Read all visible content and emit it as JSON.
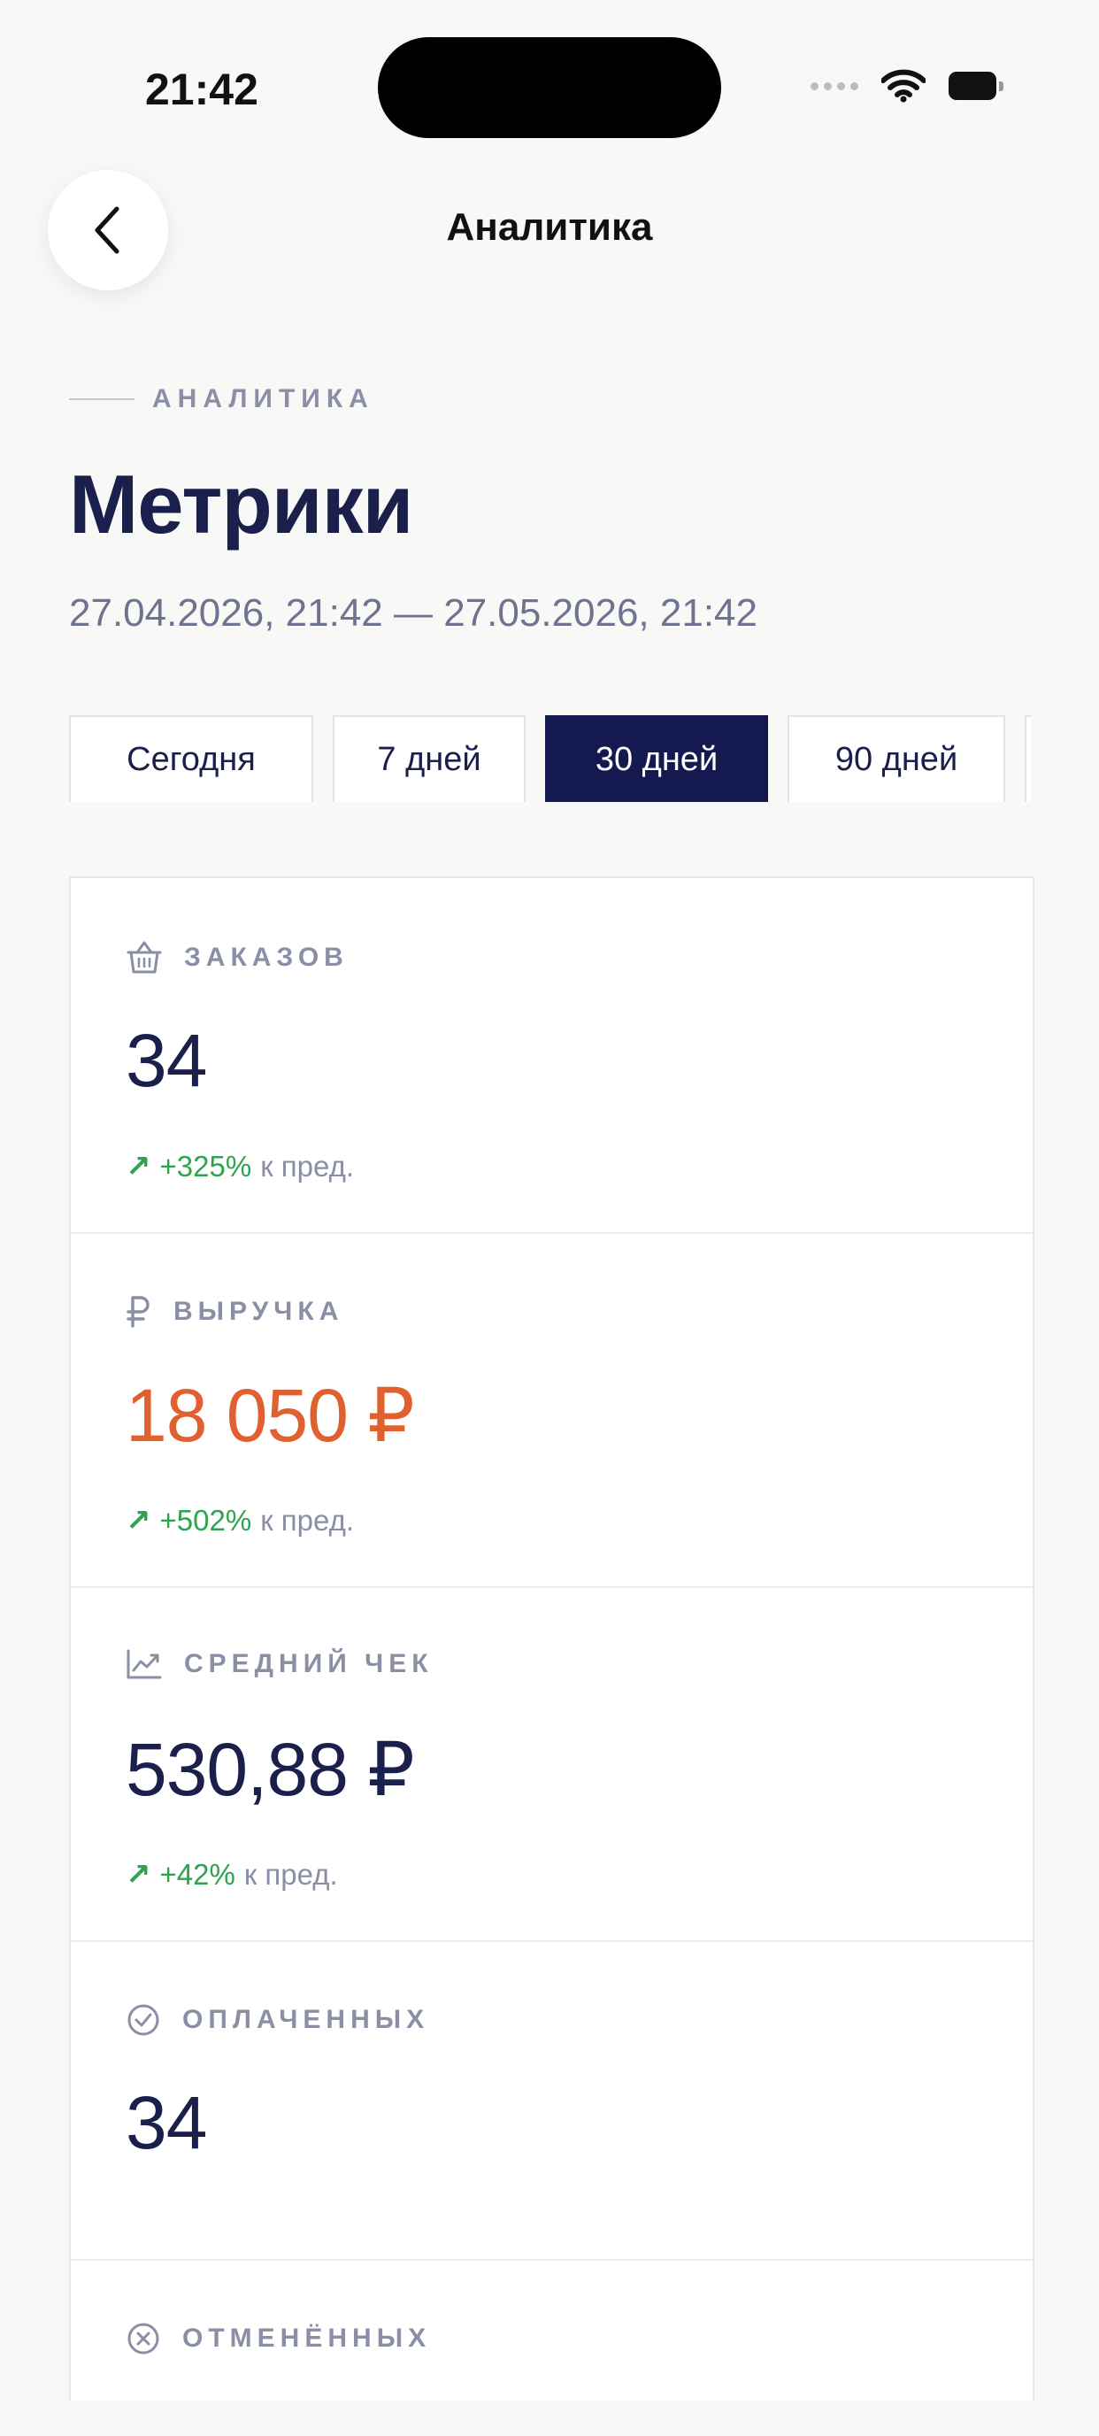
{
  "status_bar": {
    "time": "21:42",
    "wifi_icon": "wifi-icon",
    "battery_icon": "battery-icon"
  },
  "nav": {
    "title": "Аналитика",
    "back_icon": "chevron-left-icon"
  },
  "section": {
    "eyebrow": "АНАЛИТИКА",
    "title": "Метрики",
    "date_range": "27.04.2026, 21:42 — 27.05.2026, 21:42"
  },
  "period_tabs": [
    {
      "label": "Сегодня",
      "active": false
    },
    {
      "label": "7 дней",
      "active": false
    },
    {
      "label": "30 дней",
      "active": true
    },
    {
      "label": "90 дней",
      "active": false
    },
    {
      "label": "",
      "active": false
    }
  ],
  "metrics": [
    {
      "label": "ЗАКАЗОВ",
      "icon": "basket-icon",
      "value": "34",
      "delta": "+325%",
      "delta_caption": "к пред."
    },
    {
      "label": "ВЫРУЧКА",
      "icon": "ruble-icon",
      "value": "18 050 ₽",
      "delta": "+502%",
      "delta_caption": "к пред."
    },
    {
      "label": "СРЕДНИЙ ЧЕК",
      "icon": "trend-chart-icon",
      "value": "530,88 ₽",
      "delta": "+42%",
      "delta_caption": "к пред."
    },
    {
      "label": "ОПЛАЧЕННЫХ",
      "icon": "check-circle-icon",
      "value": "34"
    },
    {
      "label": "ОТМЕНЁННЫХ",
      "icon": "x-circle-icon"
    }
  ],
  "colors": {
    "primary": "#141a4f",
    "accent": "#e0602f",
    "positive": "#2ea44f",
    "muted": "#8a8fa6"
  }
}
